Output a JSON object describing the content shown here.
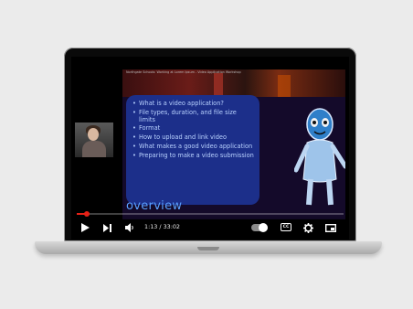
{
  "video": {
    "slide_title": "Northgate Schools: Working at Lorem Ipsum - Video Application Workshop",
    "bullets": [
      "What is a video application?",
      "File types, duration, and file size limits",
      "Format",
      "How to upload and link video",
      "What makes a good video application",
      "Preparing to make a video submission"
    ],
    "overview_label": "overview"
  },
  "player": {
    "time_label": "1:13 / 33:02",
    "progress_fraction": 0.037,
    "accent_color": "#e62117",
    "icons": [
      "play-icon",
      "next-icon",
      "volume-icon",
      "autoplay-toggle",
      "captions-icon",
      "settings-icon",
      "miniplayer-icon"
    ]
  }
}
